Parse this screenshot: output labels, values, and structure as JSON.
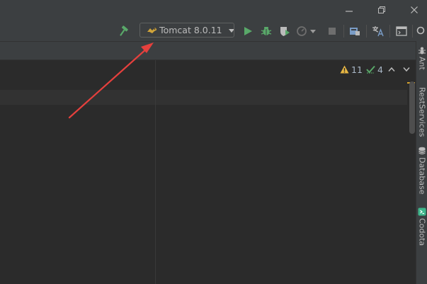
{
  "run_config": {
    "label": "Tomcat 8.0.11",
    "icon": "tomcat-icon"
  },
  "inspections": {
    "warnings": "11",
    "weak_warnings": "4"
  },
  "right_tool_tabs": [
    {
      "label": "Ant",
      "icon": "ant-icon"
    },
    {
      "label": "RestServices",
      "icon": ""
    },
    {
      "label": "Database",
      "icon": "database-icon"
    },
    {
      "label": "Codota",
      "icon": "codota-icon"
    }
  ],
  "colors": {
    "run_green": "#59a869",
    "warning_yellow": "#e8b743",
    "annotation_arrow": "#e5403d"
  }
}
